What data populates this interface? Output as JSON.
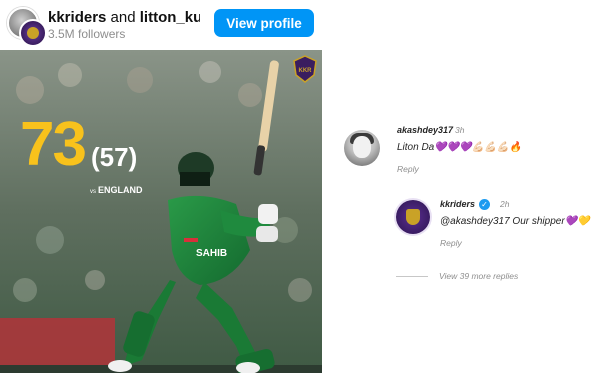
{
  "header": {
    "account_primary": "kkriders",
    "connector": "and",
    "account_secondary": "litton_kumer",
    "followers": "3.5M followers",
    "view_profile_label": "View profile"
  },
  "post": {
    "score": "73",
    "balls": "(57)",
    "vs_label": "vs",
    "opponent": "ENGLAND",
    "jersey_text": "SAHIB",
    "logo_text": "KKR"
  },
  "comments": [
    {
      "username": "akashdey317",
      "time": "3h",
      "text": "Liton Da💜💜💜💪🏻💪🏻💪🏻🔥",
      "reply_label": "Reply"
    }
  ],
  "reply": {
    "username": "kkriders",
    "verified": true,
    "time": "2h",
    "text": "@akashdey317 Our shipper💜💛",
    "reply_label": "Reply"
  },
  "view_more_replies": "View 39 more replies",
  "colors": {
    "accent_blue": "#0095f6",
    "score_yellow": "#f8c21c",
    "kkr_purple": "#3a1d5f",
    "kkr_gold": "#c9a227",
    "jersey_green": "#1f7a3a"
  }
}
